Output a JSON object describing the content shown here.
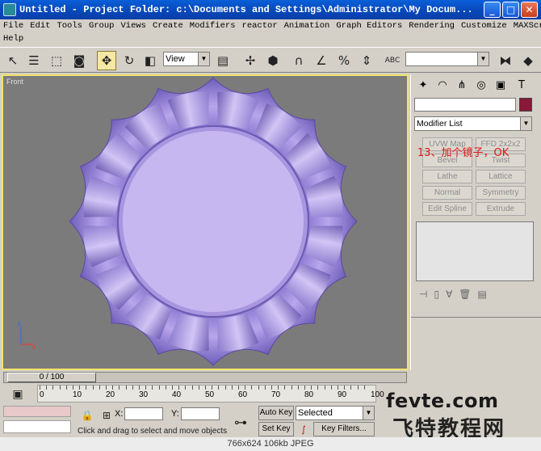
{
  "window": {
    "title": "Untitled    - Project Folder: c:\\Documents and Settings\\Administrator\\My Docum...",
    "min_glyph": "_",
    "max_glyph": "□",
    "close_glyph": "✕"
  },
  "menu": {
    "row1": [
      "File",
      "Edit",
      "Tools",
      "Group",
      "Views",
      "Create",
      "Modifiers",
      "reactor",
      "Animation",
      "Graph Editors",
      "Rendering",
      "Customize",
      "MAXScript"
    ],
    "row2": [
      "Help"
    ]
  },
  "toolbar": {
    "view_dropdown": "View",
    "abc_label": "ABC"
  },
  "viewport": {
    "label": "Front",
    "axis_x": "x",
    "axis_z": "z"
  },
  "command_panel": {
    "modifier_list": "Modifier List",
    "buttons": [
      "UVW Map",
      "FFD 2x2x2",
      "Bevel",
      "Twist",
      "Lathe",
      "Lattice",
      "Normal",
      "Symmetry",
      "Edit Spline",
      "Extrude"
    ],
    "annotation": "13、加个镜子，OK"
  },
  "timeline": {
    "frame_counter": "0 / 100",
    "ticks": [
      "0",
      "10",
      "20",
      "30",
      "40",
      "50",
      "60",
      "70",
      "80",
      "90",
      "100"
    ]
  },
  "status": {
    "x_label": "X:",
    "y_label": "Y:",
    "prompt": "Click and drag to select and move objects",
    "auto_key": "Auto Key",
    "set_key": "Set Key",
    "selected": "Selected",
    "key_filters": "Key Filters..."
  },
  "watermark": {
    "line1": "fevte.com",
    "line2": "飞特教程网"
  },
  "footer": {
    "caption": "766x624  106kb  JPEG"
  },
  "colors": {
    "plate": "#b8a6ec",
    "plate_center": "#c7b7f0",
    "viewport_bg": "#7b7b7b",
    "active_border": "#f2e36a",
    "annotation": "#e01818"
  }
}
